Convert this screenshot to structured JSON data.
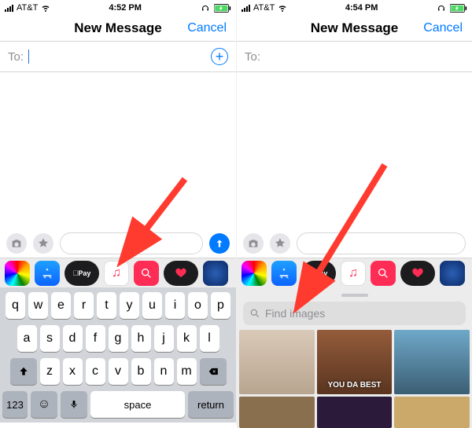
{
  "left": {
    "status": {
      "carrier": "AT&T",
      "time": "4:52 PM"
    },
    "header": {
      "title": "New Message",
      "cancel": "Cancel"
    },
    "to": {
      "label": "To:"
    },
    "keyboard": {
      "rows": [
        [
          "q",
          "w",
          "e",
          "r",
          "t",
          "y",
          "u",
          "i",
          "o",
          "p"
        ],
        [
          "a",
          "s",
          "d",
          "f",
          "g",
          "h",
          "j",
          "k",
          "l"
        ],
        [
          "z",
          "x",
          "c",
          "v",
          "b",
          "n",
          "m"
        ]
      ],
      "num": "123",
      "space": "space",
      "return": "return"
    }
  },
  "right": {
    "status": {
      "carrier": "AT&T",
      "time": "4:54 PM"
    },
    "header": {
      "title": "New Message",
      "cancel": "Cancel"
    },
    "to": {
      "label": "To:"
    },
    "search": {
      "placeholder": "Find images"
    },
    "gifs": {
      "captions": [
        "",
        "YOU DA BEST",
        ""
      ]
    }
  },
  "icons": {
    "photos": "photos-app-icon",
    "appstore": "appstore-icon",
    "applepay": "applepay-icon",
    "music": "music-icon",
    "images": "images-icon",
    "digitaltouch": "digitaltouch-icon",
    "more": "more-icon"
  }
}
